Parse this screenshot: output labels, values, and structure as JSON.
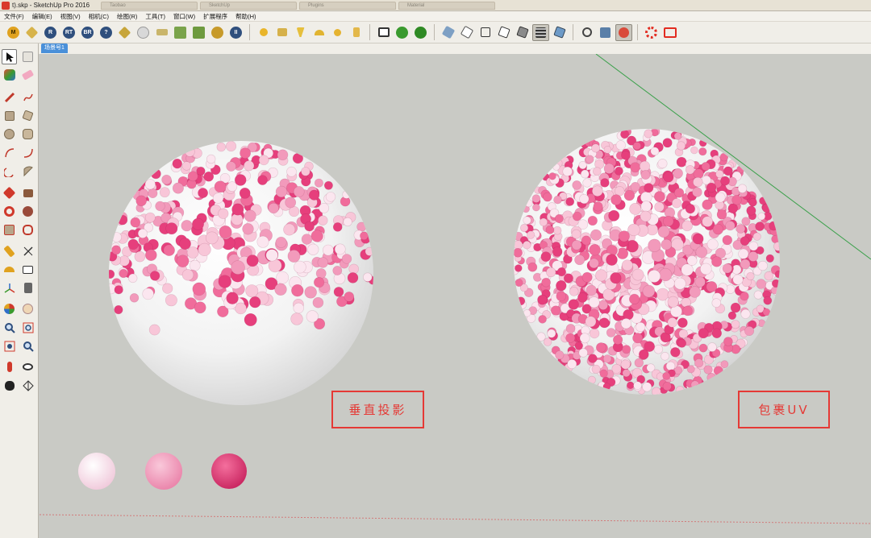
{
  "window": {
    "title": "t).skp - SketchUp Pro 2016",
    "ghost_tabs": [
      "Taobao",
      "SketchUp",
      "Plugins",
      "Material"
    ]
  },
  "menu": {
    "items": [
      "文件(F)",
      "编辑(E)",
      "视图(V)",
      "相机(C)",
      "绘图(R)",
      "工具(T)",
      "窗口(W)",
      "扩展程序",
      "帮助(H)"
    ]
  },
  "toolbar": {
    "icon_labels": [
      "M",
      "R",
      "RT",
      "BR"
    ]
  },
  "scene": {
    "tab_label": "场景号1"
  },
  "viewport": {
    "label_left": "垂直投影",
    "label_right": "包裹UV",
    "swatch_colors": [
      "#f6dcea",
      "#f2a1c2",
      "#e63f7c"
    ],
    "sphere_color": "#ffffff",
    "dot_colors": [
      "#e63f7c",
      "#f06c9b",
      "#f29abb",
      "#f8c6d8",
      "#fbe6ef"
    ],
    "axis_color": "#3aa04a"
  }
}
